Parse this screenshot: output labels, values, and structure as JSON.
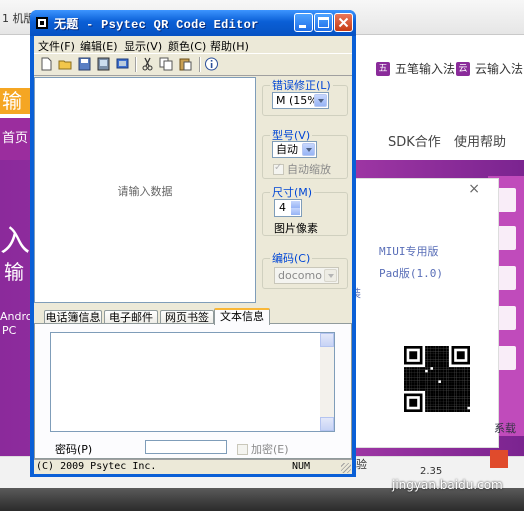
{
  "background": {
    "browser_tab_label": "1 机版 -",
    "ime_links": [
      {
        "icon": "五",
        "label": "五笔输入法"
      },
      {
        "icon": "云",
        "label": "云输入法"
      }
    ],
    "nav": {
      "home": "首页",
      "items": [
        "SDK合作",
        "使用帮助"
      ]
    },
    "hero_fragments": [
      "输",
      "入",
      "输",
      "Androi",
      "PC"
    ],
    "panel": {
      "links": [
        "MIUI专用版",
        "Pad版(1.0)"
      ],
      "partial_link": "装",
      "close": "×"
    },
    "partial_side_text": "系载",
    "partial_bottom_text": "验",
    "bottom_partial_value": "2.35",
    "watermark": "jingyan.baidu.com"
  },
  "window": {
    "title": "无题 - Psytec QR Code Editor",
    "menu": [
      "文件(F)",
      "编辑(E)",
      "显示(V)",
      "颜色(C)",
      "帮助(H)"
    ],
    "preview_placeholder": "请输入数据",
    "error_correction": {
      "label": "错误修正(L)",
      "value": "M (15%)"
    },
    "model": {
      "label": "型号(V)",
      "value": "自动",
      "auto_scale_label": "自动缩放",
      "auto_scale_checked": true
    },
    "size": {
      "label": "尺寸(M)",
      "value": "4",
      "unit": "图片像素"
    },
    "encoding": {
      "label": "编码(C)",
      "value": "docomo"
    },
    "tabs": [
      "电话簿信息",
      "电子邮件",
      "网页书签",
      "文本信息"
    ],
    "active_tab": "文本信息",
    "password": {
      "label": "密码(P)",
      "value": ""
    },
    "encrypt": {
      "label": "加密(E)",
      "checked": false
    },
    "status": {
      "copyright": "(C) 2009 Psytec Inc.",
      "num": "NUM"
    }
  }
}
